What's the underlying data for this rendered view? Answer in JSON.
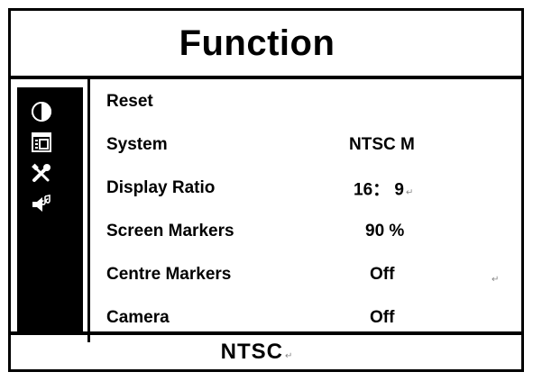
{
  "header": {
    "title": "Function"
  },
  "sidebar": {
    "icons": [
      {
        "name": "picture-icon"
      },
      {
        "name": "function-icon"
      },
      {
        "name": "tools-icon"
      },
      {
        "name": "audio-icon"
      }
    ]
  },
  "menu": {
    "items": [
      {
        "label": "Reset",
        "value": ""
      },
      {
        "label": "System",
        "value": "NTSC M"
      },
      {
        "label": "Display Ratio",
        "value": "16： 9"
      },
      {
        "label": "Screen Markers",
        "value": "90 %"
      },
      {
        "label": "Centre Markers",
        "value": "Off"
      },
      {
        "label": "Camera",
        "value": "Off"
      }
    ]
  },
  "footer": {
    "status": "NTSC"
  }
}
